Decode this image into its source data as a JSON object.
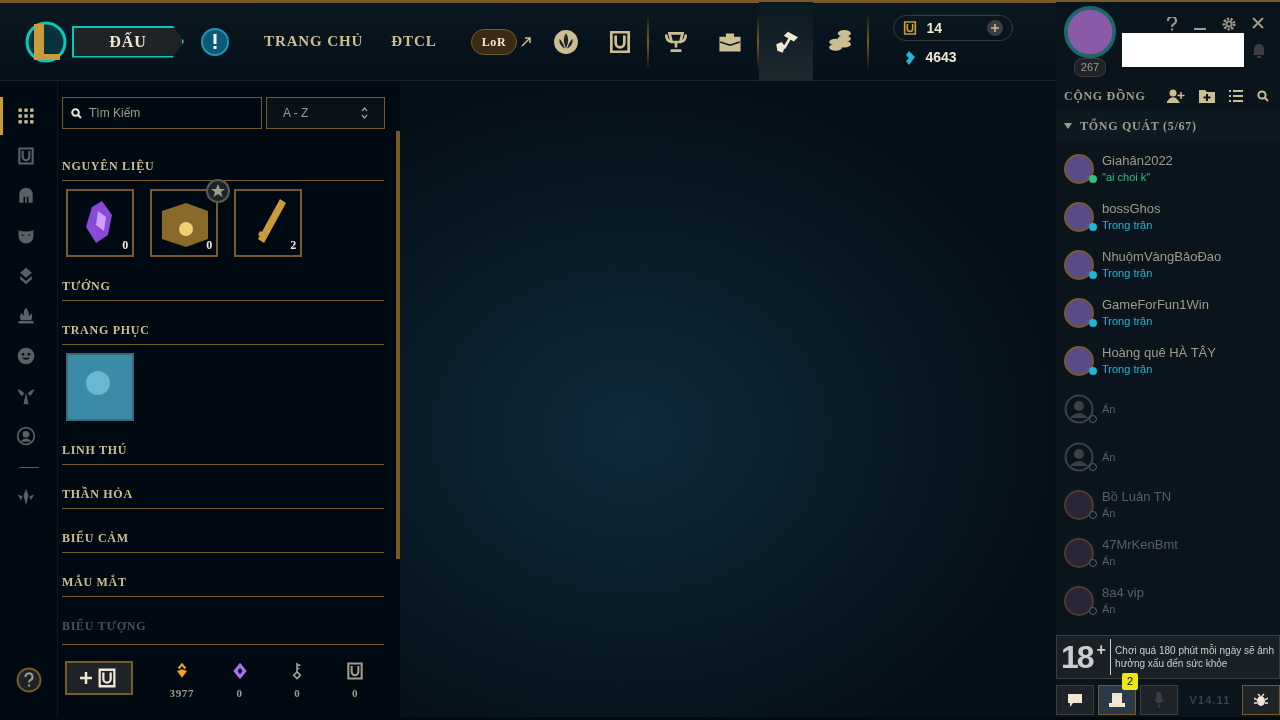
{
  "nav": {
    "play_button": "ĐẤU",
    "tabs": [
      {
        "label": "TRANG CHỦ",
        "selected": false
      },
      {
        "label": "ĐTCL",
        "selected": false
      }
    ],
    "lor_button": "LoR",
    "icon_tabs": [
      {
        "kind": "emblem",
        "selected": false
      },
      {
        "kind": "collection",
        "selected": false
      },
      {
        "kind": "trophy",
        "selected": false
      },
      {
        "kind": "bag",
        "selected": false
      },
      {
        "kind": "loot",
        "selected": true
      },
      {
        "kind": "coins",
        "selected": false
      }
    ]
  },
  "wallet": {
    "rp": "14",
    "be": "4643"
  },
  "profile": {
    "level": "267"
  },
  "loot": {
    "search": {
      "placeholder": "Tìm Kiếm"
    },
    "sort": "A - Z",
    "rail": [
      {
        "kind": "grid",
        "selected": true
      },
      {
        "kind": "collection",
        "selected": false
      },
      {
        "kind": "helmet",
        "selected": false
      },
      {
        "kind": "mask",
        "selected": false
      },
      {
        "kind": "ward",
        "selected": false
      },
      {
        "kind": "flame",
        "selected": false
      },
      {
        "kind": "smile",
        "selected": false
      },
      {
        "kind": "wings",
        "selected": false
      },
      {
        "kind": "user",
        "selected": false
      },
      {
        "kind": "crest",
        "selected": false
      }
    ],
    "categories": [
      {
        "title": "NGUYÊN LIỆU",
        "faded": false,
        "items": [
          {
            "kind": "gem",
            "count": "0",
            "starred": false
          },
          {
            "kind": "chest",
            "count": "0",
            "starred": true
          },
          {
            "kind": "key",
            "count": "2",
            "starred": false
          }
        ]
      },
      {
        "title": "TƯỚNG",
        "faded": false
      },
      {
        "title": "TRANG PHỤC",
        "faded": false,
        "items": [
          {
            "kind": "skin",
            "starred": false
          }
        ]
      },
      {
        "title": "LINH THÚ",
        "faded": false
      },
      {
        "title": "THẦN HỎA",
        "faded": false
      },
      {
        "title": "BIỂU CẢM",
        "faded": false
      },
      {
        "title": "MẮU MẮT",
        "faded": false
      },
      {
        "title": "BIỂU TƯỢNG",
        "faded": true
      }
    ],
    "totals": [
      {
        "kind": "orange-essence",
        "value": "3977"
      },
      {
        "kind": "mythic-essence",
        "value": "0"
      },
      {
        "kind": "key-fragment",
        "value": "0"
      },
      {
        "kind": "collection",
        "value": "0"
      }
    ]
  },
  "social": {
    "title": "CỘNG ĐỒNG",
    "group": "TỔNG QUÁT (5/67)",
    "friends": [
      {
        "name": "Giahân2022",
        "status": "\"ai choi k\"",
        "kind": "chat",
        "color": "#2ec27e"
      },
      {
        "name": "bossGhos",
        "status": "Trong trận",
        "kind": "ingame",
        "color": "#1fb6d9"
      },
      {
        "name": "NhuộmVàngBảoĐao",
        "status": "Trong trận",
        "kind": "ingame",
        "color": "#1fb6d9"
      },
      {
        "name": "GameForFun1Win",
        "status": "Trong trận",
        "kind": "ingame",
        "color": "#1fb6d9"
      },
      {
        "name": "Hoàng quê HÀ TÂY",
        "status": "Trong trận",
        "kind": "ingame",
        "color": "#1fb6d9"
      },
      {
        "status": "Ẩn",
        "kind": "offline",
        "color": "#5a6066"
      },
      {
        "status": "Ẩn",
        "kind": "offline",
        "color": "#5a6066"
      },
      {
        "name": "Bồ Luân TN",
        "status": "Ẩn",
        "kind": "offline",
        "color": "#5a6066"
      },
      {
        "name": "47MrKenBmt",
        "status": "Ẩn",
        "kind": "offline",
        "color": "#5a6066"
      },
      {
        "name": "8a4 vip",
        "status": "Ẩn",
        "kind": "offline",
        "color": "#5a6066"
      }
    ]
  },
  "notice": {
    "age": "18",
    "plus": "+",
    "text": "Chơi quá 180 phút mỗi ngày sẽ ảnh hưởng xấu đến sức khỏe"
  },
  "footer": {
    "badge": "2",
    "version": "V14.11"
  }
}
